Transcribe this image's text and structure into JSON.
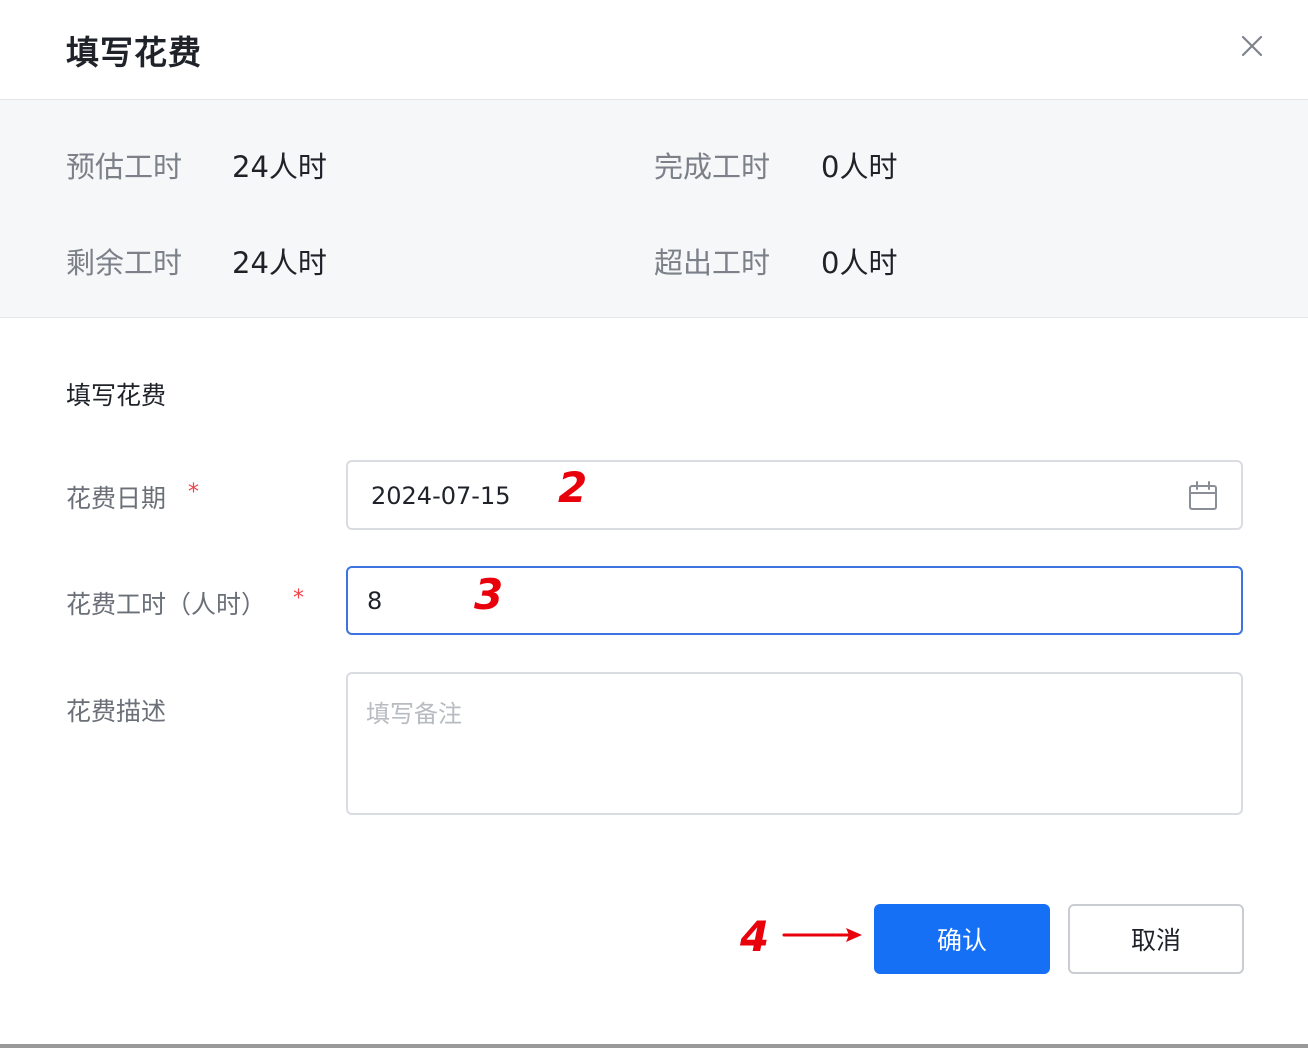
{
  "dialog": {
    "title": "填写花费",
    "close_icon": "close-icon"
  },
  "summary": {
    "estimated": {
      "label": "预估工时",
      "value": "24人时"
    },
    "completed": {
      "label": "完成工时",
      "value": "0人时"
    },
    "remaining": {
      "label": "剩余工时",
      "value": "24人时"
    },
    "exceeded": {
      "label": "超出工时",
      "value": "0人时"
    }
  },
  "form": {
    "section_title": "填写花费",
    "date": {
      "label": "花费日期",
      "required_mark": "*",
      "value": "2024-07-15",
      "icon": "calendar-icon"
    },
    "hours": {
      "label": "花费工时（人时）",
      "required_mark": "*",
      "value": "8"
    },
    "description": {
      "label": "花费描述",
      "placeholder": "填写备注",
      "value": ""
    }
  },
  "buttons": {
    "confirm": "确认",
    "cancel": "取消"
  },
  "annotations": {
    "step_2": "2",
    "step_3": "3",
    "step_4": "4"
  },
  "colors": {
    "primary": "#1670f5",
    "focus_border": "#3d74e0",
    "required": "#f2434a",
    "annotation": "#e8000b"
  }
}
